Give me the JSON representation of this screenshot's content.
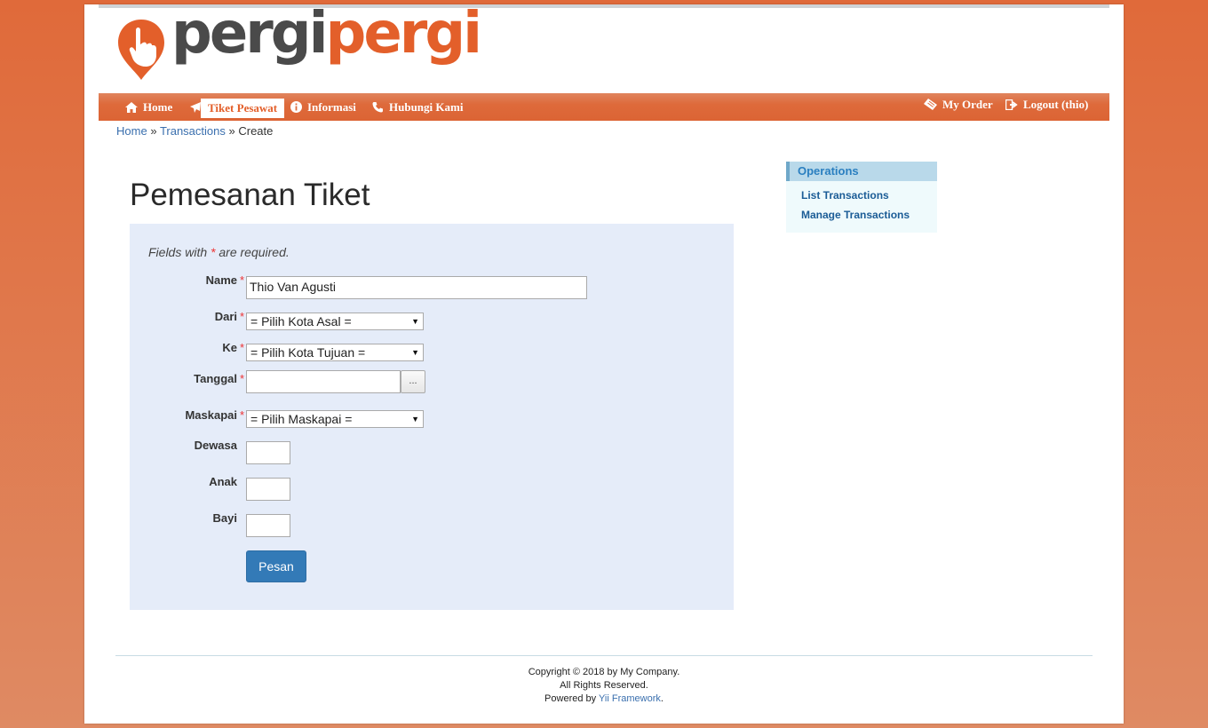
{
  "logo": {
    "part1": "pergi",
    "part2": "pergi"
  },
  "nav": {
    "left": [
      {
        "label": "Home",
        "icon": "home-icon"
      },
      {
        "label": "Tiket Pesawat",
        "icon": "plane-icon"
      },
      {
        "label": "Informasi",
        "icon": "info-icon"
      },
      {
        "label": "Hubungi Kami",
        "icon": "phone-icon"
      }
    ],
    "right": [
      {
        "label": "My Order",
        "icon": "ticket-icon"
      },
      {
        "label": "Logout (thio)",
        "icon": "logout-icon"
      }
    ]
  },
  "breadcrumb": {
    "home": "Home",
    "sep1": "»",
    "transactions": "Transactions",
    "sep2": "»",
    "current": "Create"
  },
  "page_title": "Pemesanan Tiket",
  "form": {
    "note_before": "Fields with",
    "note_star": "*",
    "note_after": "are required.",
    "fields": {
      "name": {
        "label": "Name",
        "value": "Thio Van Agusti"
      },
      "dari": {
        "label": "Dari",
        "value": "= Pilih Kota Asal ="
      },
      "ke": {
        "label": "Ke",
        "value": "= Pilih Kota Tujuan ="
      },
      "tanggal": {
        "label": "Tanggal",
        "value": "",
        "button": "..."
      },
      "maskapai": {
        "label": "Maskapai",
        "value": "= Pilih Maskapai ="
      },
      "dewasa": {
        "label": "Dewasa",
        "value": ""
      },
      "anak": {
        "label": "Anak",
        "value": ""
      },
      "bayi": {
        "label": "Bayi",
        "value": ""
      }
    },
    "required_mark": "*",
    "submit": "Pesan"
  },
  "sidebar": {
    "header": "Operations",
    "items": [
      "List Transactions",
      "Manage Transactions"
    ]
  },
  "footer": {
    "line1": "Copyright © 2018 by My Company.",
    "line2": "All Rights Reserved.",
    "line3_prefix": "Powered by",
    "line3_link": "Yii Framework",
    "line3_suffix": "."
  },
  "colors": {
    "brand_orange": "#e35f2a",
    "primary_button": "#337ab7",
    "form_bg": "#e5ecf9"
  }
}
